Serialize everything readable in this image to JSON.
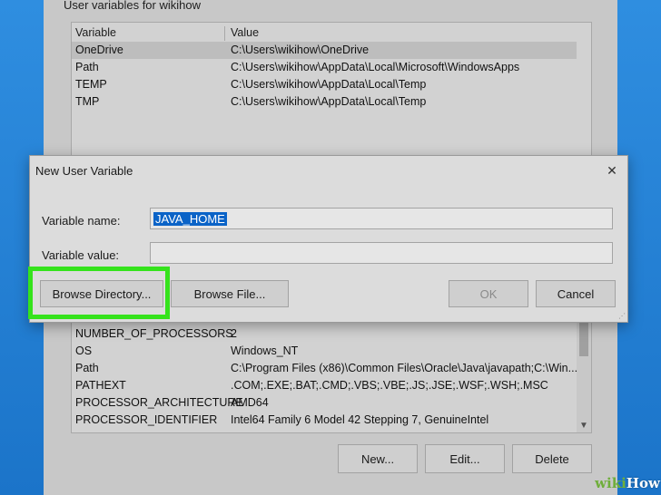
{
  "background_window": {
    "group_title": "User variables for wikihow",
    "user_list": {
      "headers": [
        "Variable",
        "Value"
      ],
      "rows": [
        {
          "variable": "OneDrive",
          "value": "C:\\Users\\wikihow\\OneDrive",
          "selected": true
        },
        {
          "variable": "Path",
          "value": "C:\\Users\\wikihow\\AppData\\Local\\Microsoft\\WindowsApps"
        },
        {
          "variable": "TEMP",
          "value": "C:\\Users\\wikihow\\AppData\\Local\\Temp"
        },
        {
          "variable": "TMP",
          "value": "C:\\Users\\wikihow\\AppData\\Local\\Temp"
        }
      ]
    },
    "system_list": {
      "rows": [
        {
          "variable": "NUMBER_OF_PROCESSORS",
          "value": "2"
        },
        {
          "variable": "OS",
          "value": "Windows_NT"
        },
        {
          "variable": "Path",
          "value": "C:\\Program Files (x86)\\Common Files\\Oracle\\Java\\javapath;C:\\Win..."
        },
        {
          "variable": "PATHEXT",
          "value": ".COM;.EXE;.BAT;.CMD;.VBS;.VBE;.JS;.JSE;.WSF;.WSH;.MSC"
        },
        {
          "variable": "PROCESSOR_ARCHITECTURE",
          "value": "AMD64"
        },
        {
          "variable": "PROCESSOR_IDENTIFIER",
          "value": "Intel64 Family 6 Model 42 Stepping 7, GenuineIntel"
        }
      ]
    },
    "buttons": {
      "new": "New...",
      "edit": "Edit...",
      "delete": "Delete"
    }
  },
  "dialog": {
    "title": "New User Variable",
    "close_glyph": "✕",
    "variable_name_label": "Variable name:",
    "variable_name_value": "JAVA_HOME",
    "variable_value_label": "Variable value:",
    "variable_value_value": "",
    "buttons": {
      "browse_directory": "Browse Directory...",
      "browse_file": "Browse File...",
      "ok": "OK",
      "cancel": "Cancel"
    }
  },
  "watermark": {
    "part1": "wiki",
    "part2": "How"
  },
  "colors": {
    "highlight": "#35e31c",
    "selection": "#0a63c7",
    "desktop": "#1a7fd0"
  }
}
